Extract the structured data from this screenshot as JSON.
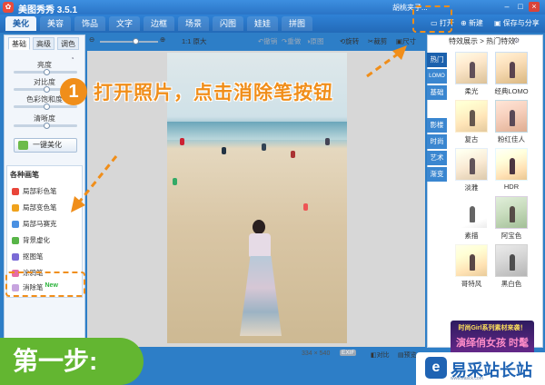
{
  "app": {
    "title": "美图秀秀 3.5.1",
    "logo_glyph": "✿",
    "user_name": "胡桃夹子...",
    "window_buttons": [
      "–",
      "□",
      "×"
    ]
  },
  "main_tabs": [
    {
      "label": "美化",
      "active": true
    },
    {
      "label": "美容",
      "active": false
    },
    {
      "label": "饰品",
      "active": false
    },
    {
      "label": "文字",
      "active": false
    },
    {
      "label": "边框",
      "active": false
    },
    {
      "label": "场景",
      "active": false
    },
    {
      "label": "闪图",
      "active": false
    },
    {
      "label": "娃娃",
      "active": false
    },
    {
      "label": "拼图",
      "active": false
    }
  ],
  "top_actions": {
    "open_label": "打开",
    "new_label": "新建",
    "save_share_label": "保存与分享"
  },
  "left_panel": {
    "subtabs": [
      {
        "label": "基础",
        "active": true
      },
      {
        "label": "高级",
        "active": false
      },
      {
        "label": "调色",
        "active": false
      }
    ],
    "sliders": [
      {
        "label": "亮度",
        "value": 0.5
      },
      {
        "label": "对比度",
        "value": 0.5
      },
      {
        "label": "色彩饱和度",
        "value": 0.5
      },
      {
        "label": "清晰度",
        "value": 0.5
      }
    ],
    "one_click_label": "一键美化",
    "brushes_title": "各种画笔",
    "brushes": [
      {
        "label": "局部彩色笔",
        "color": "#e9453a"
      },
      {
        "label": "局部变色笔",
        "color": "#f0a21c"
      },
      {
        "label": "局部马赛克",
        "color": "#4a90e2"
      },
      {
        "label": "背景虚化",
        "color": "#58b548"
      },
      {
        "label": "抠图笔",
        "color": "#7b6bd6"
      },
      {
        "label": "涂鸦笔",
        "color": "#e66da6"
      },
      {
        "label": "消除笔",
        "color": "#c7a4df"
      }
    ],
    "new_badge": "New"
  },
  "toolbar": {
    "zoom_value": 0.6,
    "zoom_label": "1:1 原大",
    "undo_label": "撤销",
    "redo_label": "重做",
    "restore_label": "原图",
    "rotate_label": "旋转",
    "crop_label": "裁剪",
    "resize_label": "尺寸"
  },
  "status": {
    "image_size": "334 × 540",
    "exif_label": "EXIF",
    "compare_label": "对比",
    "preview_label": "预览"
  },
  "right_panel": {
    "header": "特效展示 > 热门特效",
    "categories": [
      {
        "label": "热门",
        "active": true
      },
      {
        "label": "LOMO",
        "active": false
      },
      {
        "label": "基础",
        "active": false
      },
      {
        "label": "影楼",
        "active": false
      },
      {
        "label": "时尚",
        "active": false
      },
      {
        "label": "艺术",
        "active": false
      },
      {
        "label": "渐变",
        "active": false
      }
    ],
    "effects": [
      "柔光",
      "经典LOMO",
      "复古",
      "粉红佳人",
      "淡雅",
      "HDR",
      "素描",
      "阿宝色",
      "哥特风",
      "黑白色"
    ],
    "ad_text": "时尚Girl系列素材来袭！",
    "ad_sub": "演绎俏女孩 时髦"
  },
  "annotations": {
    "step_number": "1",
    "instruction": "打开照片，点击消除笔按钮",
    "step_banner": "第一步:",
    "accent_color": "#f08e1a"
  },
  "watermark": {
    "logo_glyph": "e",
    "text": "易采站长站",
    "sub": "www.easck.com"
  },
  "colors": {
    "brand_blue": "#2d7ec7",
    "annotation_orange": "#f08e1a",
    "step_green": "#63b631"
  }
}
